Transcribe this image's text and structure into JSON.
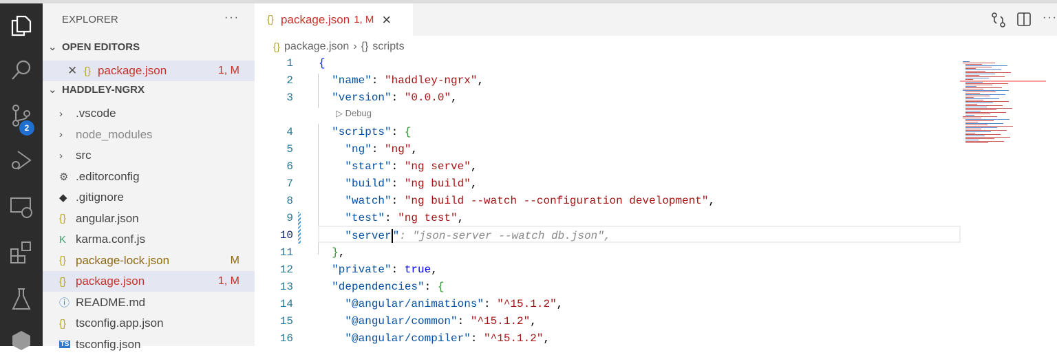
{
  "activity": {
    "scm_badge": "2"
  },
  "sidebar": {
    "title": "EXPLORER",
    "more": "···",
    "open_editors": {
      "label": "OPEN EDITORS",
      "items": [
        {
          "name": "package.json",
          "status": "1, M"
        }
      ]
    },
    "project": {
      "label": "HADDLEY-NGRX",
      "items": [
        {
          "name": ".vscode",
          "kind": "folder",
          "icon": "chevron-right"
        },
        {
          "name": "node_modules",
          "kind": "folder",
          "icon": "chevron-right"
        },
        {
          "name": "src",
          "kind": "folder",
          "icon": "chevron-right"
        },
        {
          "name": ".editorconfig",
          "icon": "gear"
        },
        {
          "name": ".gitignore",
          "icon": "git"
        },
        {
          "name": "angular.json",
          "icon": "json"
        },
        {
          "name": "karma.conf.js",
          "icon": "karma"
        },
        {
          "name": "package-lock.json",
          "icon": "json",
          "status": "M"
        },
        {
          "name": "package.json",
          "icon": "json",
          "status": "1, M"
        },
        {
          "name": "README.md",
          "icon": "info"
        },
        {
          "name": "tsconfig.app.json",
          "icon": "json"
        },
        {
          "name": "tsconfig.json",
          "icon": "ts"
        }
      ]
    }
  },
  "tab": {
    "name": "package.json",
    "status": "1, M",
    "close": "×"
  },
  "breadcrumb": {
    "file": "package.json",
    "sep": "›",
    "symbol": "scripts",
    "br": "{}"
  },
  "codelens": "Debug",
  "code": [
    {
      "n": "1",
      "t": [
        [
          "b1",
          "{"
        ]
      ]
    },
    {
      "n": "2",
      "t": [
        [
          "k",
          "  \"name\""
        ],
        [
          "p",
          ": "
        ],
        [
          "s",
          "\"haddley-ngrx\""
        ],
        [
          "p",
          ","
        ]
      ]
    },
    {
      "n": "3",
      "t": [
        [
          "k",
          "  \"version\""
        ],
        [
          "p",
          ": "
        ],
        [
          "s",
          "\"0.0.0\""
        ],
        [
          "p",
          ","
        ]
      ]
    },
    {
      "n": "4",
      "t": [
        [
          "k",
          "  \"scripts\""
        ],
        [
          "p",
          ": "
        ],
        [
          "b2",
          "{"
        ]
      ]
    },
    {
      "n": "5",
      "t": [
        [
          "k",
          "    \"ng\""
        ],
        [
          "p",
          ": "
        ],
        [
          "s",
          "\"ng\""
        ],
        [
          "p",
          ","
        ]
      ]
    },
    {
      "n": "6",
      "t": [
        [
          "k",
          "    \"start\""
        ],
        [
          "p",
          ": "
        ],
        [
          "s",
          "\"ng serve\""
        ],
        [
          "p",
          ","
        ]
      ]
    },
    {
      "n": "7",
      "t": [
        [
          "k",
          "    \"build\""
        ],
        [
          "p",
          ": "
        ],
        [
          "s",
          "\"ng build\""
        ],
        [
          "p",
          ","
        ]
      ]
    },
    {
      "n": "8",
      "t": [
        [
          "k",
          "    \"watch\""
        ],
        [
          "p",
          ": "
        ],
        [
          "s",
          "\"ng build --watch --configuration development\""
        ],
        [
          "p",
          ","
        ]
      ]
    },
    {
      "n": "9",
      "t": [
        [
          "k",
          "    \"test\""
        ],
        [
          "p",
          ": "
        ],
        [
          "s",
          "\"ng test\""
        ],
        [
          "p",
          ","
        ]
      ]
    },
    {
      "n": "10",
      "t": [
        [
          "k",
          "    \"server"
        ],
        [
          "p",
          "|"
        ],
        [
          "k",
          "\""
        ],
        [
          "g",
          ": \"json-server --watch db.json\","
        ]
      ]
    },
    {
      "n": "11",
      "t": [
        [
          "b2",
          "  }"
        ],
        [
          "p",
          ","
        ]
      ]
    },
    {
      "n": "12",
      "t": [
        [
          "k",
          "  \"private\""
        ],
        [
          "p",
          ": "
        ],
        [
          "kw",
          "true"
        ],
        [
          "p",
          ","
        ]
      ]
    },
    {
      "n": "13",
      "t": [
        [
          "k",
          "  \"dependencies\""
        ],
        [
          "p",
          ": "
        ],
        [
          "b2",
          "{"
        ]
      ]
    },
    {
      "n": "14",
      "t": [
        [
          "k",
          "    \"@angular/animations\""
        ],
        [
          "p",
          ": "
        ],
        [
          "s",
          "\"^15.1.2\""
        ],
        [
          "p",
          ","
        ]
      ]
    },
    {
      "n": "15",
      "t": [
        [
          "k",
          "    \"@angular/common\""
        ],
        [
          "p",
          ": "
        ],
        [
          "s",
          "\"^15.1.2\""
        ],
        [
          "p",
          ","
        ]
      ]
    },
    {
      "n": "16",
      "t": [
        [
          "k",
          "    \"@angular/compiler\""
        ],
        [
          "p",
          ": "
        ],
        [
          "s",
          "\"^15.1.2\""
        ],
        [
          "p",
          ","
        ]
      ]
    }
  ],
  "colors": {
    "modified": "#c4332b",
    "lock_modified": "#8d6a13",
    "accent": "#1f6fd0"
  }
}
